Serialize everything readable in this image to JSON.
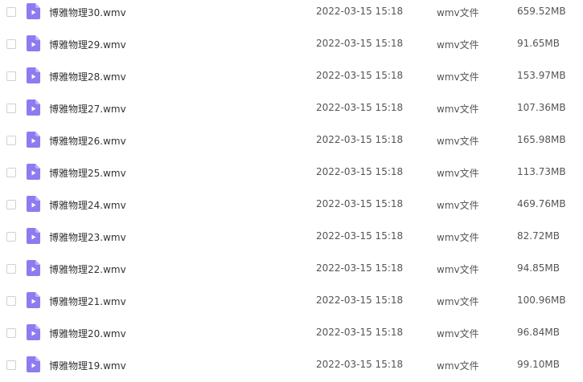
{
  "file_list": {
    "icon": "video-file-icon",
    "accent_color": "#8c7cf0",
    "rows": [
      {
        "name": "博雅物理30.wmv",
        "date": "2022-03-15 15:18",
        "type": "wmv文件",
        "size": "659.52MB"
      },
      {
        "name": "博雅物理29.wmv",
        "date": "2022-03-15 15:18",
        "type": "wmv文件",
        "size": "91.65MB"
      },
      {
        "name": "博雅物理28.wmv",
        "date": "2022-03-15 15:18",
        "type": "wmv文件",
        "size": "153.97MB"
      },
      {
        "name": "博雅物理27.wmv",
        "date": "2022-03-15 15:18",
        "type": "wmv文件",
        "size": "107.36MB"
      },
      {
        "name": "博雅物理26.wmv",
        "date": "2022-03-15 15:18",
        "type": "wmv文件",
        "size": "165.98MB"
      },
      {
        "name": "博雅物理25.wmv",
        "date": "2022-03-15 15:18",
        "type": "wmv文件",
        "size": "113.73MB"
      },
      {
        "name": "博雅物理24.wmv",
        "date": "2022-03-15 15:18",
        "type": "wmv文件",
        "size": "469.76MB"
      },
      {
        "name": "博雅物理23.wmv",
        "date": "2022-03-15 15:18",
        "type": "wmv文件",
        "size": "82.72MB"
      },
      {
        "name": "博雅物理22.wmv",
        "date": "2022-03-15 15:18",
        "type": "wmv文件",
        "size": "94.85MB"
      },
      {
        "name": "博雅物理21.wmv",
        "date": "2022-03-15 15:18",
        "type": "wmv文件",
        "size": "100.96MB"
      },
      {
        "name": "博雅物理20.wmv",
        "date": "2022-03-15 15:18",
        "type": "wmv文件",
        "size": "96.84MB"
      },
      {
        "name": "博雅物理19.wmv",
        "date": "2022-03-15 15:18",
        "type": "wmv文件",
        "size": "99.10MB"
      }
    ]
  }
}
